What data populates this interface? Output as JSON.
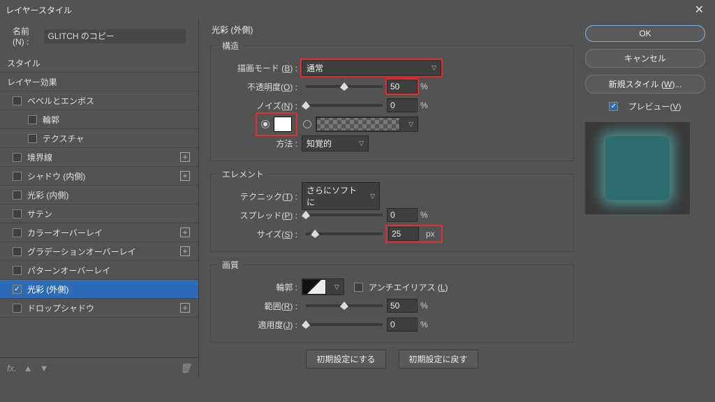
{
  "window": {
    "title": "レイヤースタイル"
  },
  "name": {
    "label": "名前(N) :",
    "value": "GLITCH のコピー"
  },
  "sidebar": {
    "header": "スタイル",
    "layer_effects": "レイヤー効果",
    "items": [
      {
        "label": "ベベルとエンボス",
        "checked": false,
        "add": false
      },
      {
        "label": "輪郭",
        "checked": false,
        "sub": true
      },
      {
        "label": "テクスチャ",
        "checked": false,
        "sub": true
      },
      {
        "label": "境界線",
        "checked": false,
        "add": true
      },
      {
        "label": "シャドウ (内側)",
        "checked": false,
        "add": true
      },
      {
        "label": "光彩 (内側)",
        "checked": false
      },
      {
        "label": "サテン",
        "checked": false
      },
      {
        "label": "カラーオーバーレイ",
        "checked": false,
        "add": true
      },
      {
        "label": "グラデーションオーバーレイ",
        "checked": false,
        "add": true
      },
      {
        "label": "パターンオーバーレイ",
        "checked": false
      },
      {
        "label": "光彩 (外側)",
        "checked": true,
        "active": true
      },
      {
        "label": "ドロップシャドウ",
        "checked": false,
        "add": true
      }
    ],
    "footer": {
      "fx": "fx.",
      "up": "▲",
      "down": "▼",
      "trash": "🗑"
    }
  },
  "panel": {
    "title": "光彩 (外側)",
    "structure": {
      "legend": "構造",
      "blend_mode": {
        "label": "描画モード (B) :",
        "value": "通常"
      },
      "opacity": {
        "label": "不透明度(O) :",
        "value": "50",
        "unit": "%",
        "pos": 50
      },
      "noise": {
        "label": "ノイズ(N) :",
        "value": "0",
        "unit": "%",
        "pos": 0
      },
      "method": {
        "label": "方法 :",
        "value": "知覚的"
      }
    },
    "element": {
      "legend": "エレメント",
      "technique": {
        "label": "テクニック(T) :",
        "value": "さらにソフト に"
      },
      "spread": {
        "label": "スプレッド(P) :",
        "value": "0",
        "unit": "%",
        "pos": 0
      },
      "size": {
        "label": "サイズ(S) :",
        "value": "25",
        "unit": "px",
        "pos": 12
      }
    },
    "quality": {
      "legend": "画質",
      "contour": {
        "label": "輪郭 :"
      },
      "antialias": {
        "label": "アンチエイリアス (L)"
      },
      "range": {
        "label": "範囲(R) :",
        "value": "50",
        "unit": "%",
        "pos": 50
      },
      "jitter": {
        "label": "適用度(J) :",
        "value": "0",
        "unit": "%",
        "pos": 0
      }
    },
    "buttons": {
      "make_default": "初期設定にする",
      "reset_default": "初期設定に戻す"
    }
  },
  "right": {
    "ok": "OK",
    "cancel": "キャンセル",
    "new_style": "新規スタイル (W)...",
    "preview": "プレビュー(V)"
  }
}
